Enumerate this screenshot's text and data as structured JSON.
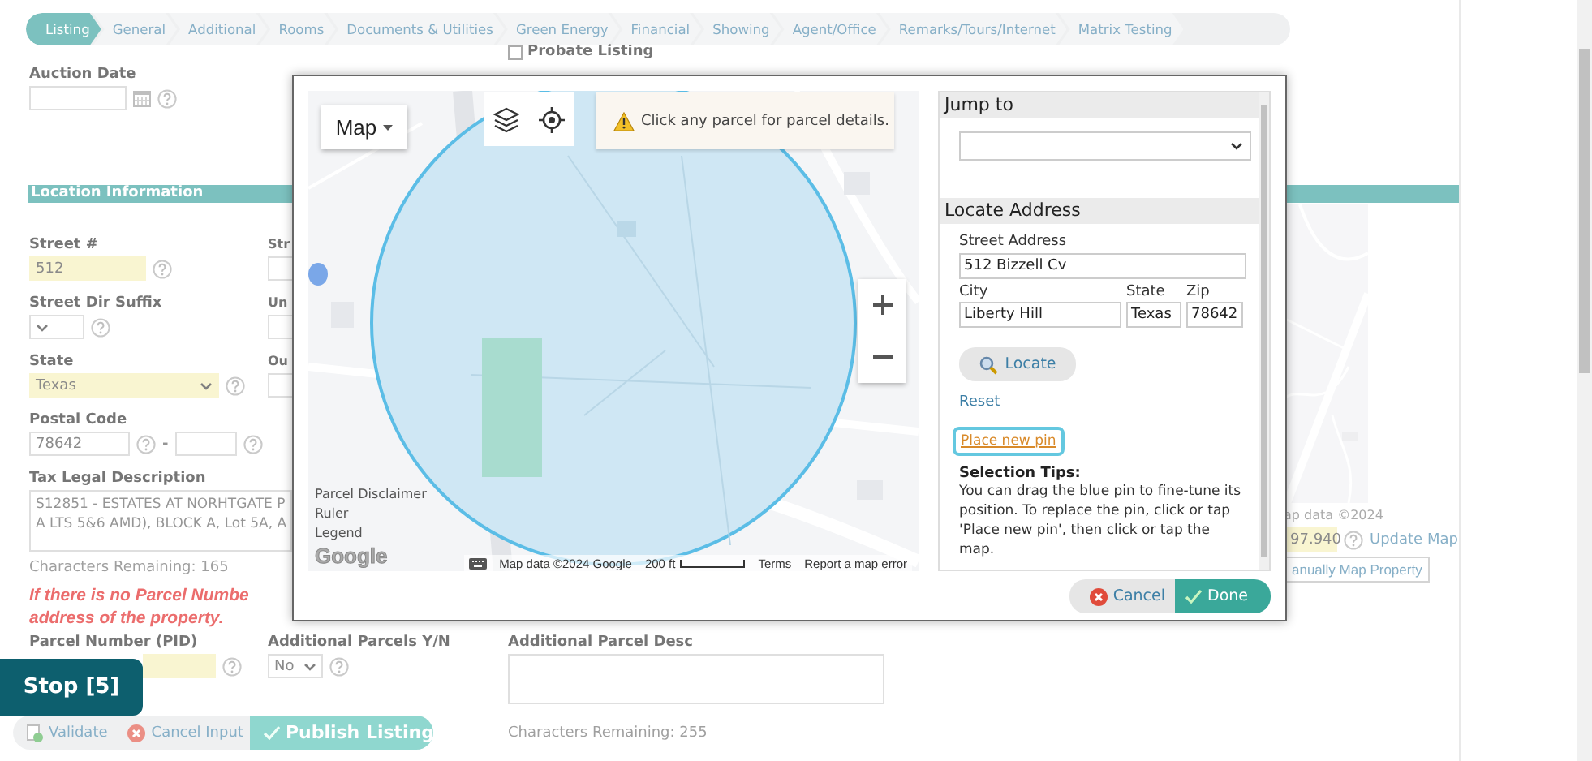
{
  "tabs": [
    {
      "label": "Listing",
      "selected": true
    },
    {
      "label": "General",
      "selected": false
    },
    {
      "label": "Additional",
      "selected": false
    },
    {
      "label": "Rooms",
      "selected": false
    },
    {
      "label": "Documents & Utilities",
      "selected": false
    },
    {
      "label": "Green Energy",
      "selected": false
    },
    {
      "label": "Financial",
      "selected": false
    },
    {
      "label": "Showing",
      "selected": false
    },
    {
      "label": "Agent/Office",
      "selected": false
    },
    {
      "label": "Remarks/Tours/Internet",
      "selected": false
    },
    {
      "label": "Matrix Testing",
      "selected": false
    }
  ],
  "auction_date": {
    "label": "Auction Date"
  },
  "probate_listing": {
    "label": "Probate Listing",
    "checked": false
  },
  "location": {
    "title": "Location Information",
    "street_number": {
      "label": "Street #",
      "value": "512",
      "required": true
    },
    "street_dir_suffix": {
      "label": "Street Dir Suffix",
      "required": false
    },
    "state": {
      "label": "State",
      "value": "Texas",
      "required": true
    },
    "postal_code": {
      "label": "Postal Code",
      "value": "78642",
      "separator": "-",
      "required": false
    },
    "column_2_labels": [
      "Str",
      "Un",
      "Ou"
    ],
    "tax_legal_description": {
      "label": "Tax Legal Description",
      "lines": [
        "S12851 - ESTATES AT NORHTGATE P",
        "A LTS 5&6 AMD), BLOCK A, Lot 5A, A"
      ]
    },
    "characters_remaining": "Characters Remaining: 165",
    "warning": [
      "If there is no Parcel Numbe",
      "address of the property."
    ],
    "parcel_number": {
      "label": "Parcel Number (PID)",
      "required": true
    },
    "additional_parcels": {
      "label": "Additional Parcels Y/N",
      "value": "No",
      "required": false
    },
    "additional_parcel_desc": {
      "label": "Additional Parcel Desc",
      "characters_remaining": "Characters Remaining: 255"
    },
    "map_side": {
      "attribution": "ap data ©2024",
      "longitude": "97.940",
      "longitude_required": true,
      "update_link": "Update Map",
      "manual_button": "anually Map Property"
    }
  },
  "toolbar": [
    {
      "label": "Validate",
      "kind": "validate"
    },
    {
      "label": "Cancel Input",
      "kind": "cancel"
    },
    {
      "label": "Publish Listing",
      "kind": "publish"
    }
  ],
  "stop_button": "Stop [5]",
  "dialog": {
    "map": {
      "type_button": "Map",
      "notice": "Click any parcel for parcel details.",
      "links": [
        "Parcel Disclaimer",
        "Ruler",
        "Legend"
      ],
      "logo": "Google",
      "footer": [
        "Map data ©2024 Google",
        "200 ft",
        "Terms",
        "Report a map error"
      ]
    },
    "panel": {
      "jump_to": "Jump to",
      "locate_title": "Locate Address",
      "fields": [
        {
          "label": "Street Address",
          "value": "512 Bizzell Cv"
        },
        {
          "label": "City",
          "value": "Liberty Hill"
        },
        {
          "label": "State",
          "value": "Texas"
        },
        {
          "label": "Zip",
          "value": "78642"
        }
      ],
      "locate_button": "Locate",
      "reset": "Reset",
      "place_pin": {
        "label": "Place new pin",
        "focused": true
      },
      "tips_title": "Selection Tips:",
      "tips": "You can drag the blue pin to fine-tune its position. To replace the pin, click or tap 'Place new pin', then click or tap the map."
    },
    "buttons": [
      {
        "label": "Cancel",
        "kind": "cancel"
      },
      {
        "label": "Done",
        "kind": "done"
      }
    ]
  }
}
